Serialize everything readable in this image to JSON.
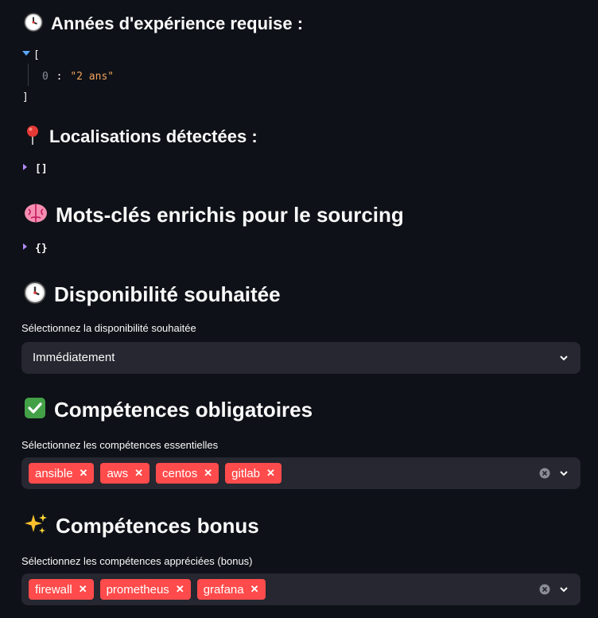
{
  "experience": {
    "icon": "clock-icon",
    "title": "Années d'expérience requise :",
    "json_open": "[",
    "item_index": "0",
    "item_sep": ":",
    "item_value": "\"2 ans\"",
    "json_close": "]"
  },
  "locations": {
    "icon": "pin-icon",
    "title": "Localisations détectées :",
    "json_value": "[]"
  },
  "keywords": {
    "icon": "brain-icon",
    "title": "Mots-clés enrichis pour le sourcing",
    "json_value": "{}"
  },
  "availability": {
    "icon": "clock-icon",
    "title": "Disponibilité souhaitée",
    "label": "Sélectionnez la disponibilité souhaitée",
    "selected": "Immédiatement"
  },
  "required_skills": {
    "icon": "check-mark-icon",
    "title": "Compétences obligatoires",
    "label": "Sélectionnez les compétences essentielles",
    "tags": [
      "ansible",
      "aws",
      "centos",
      "gitlab"
    ]
  },
  "bonus_skills": {
    "icon": "sparkles-icon",
    "title": "Compétences bonus",
    "label": "Sélectionnez les compétences appréciées (bonus)",
    "tags": [
      "firewall",
      "prometheus",
      "grafana"
    ]
  },
  "colors": {
    "background": "#0e1117",
    "input_bg": "#262730",
    "tag": "#ff4b4b",
    "json_string": "#f0a35e"
  }
}
